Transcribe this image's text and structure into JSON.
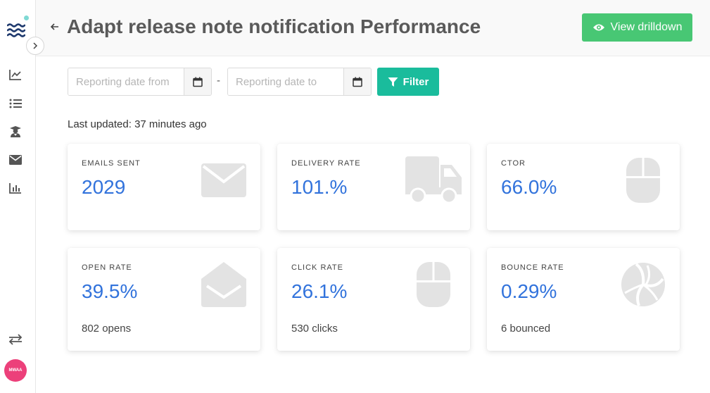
{
  "header": {
    "title": "Adapt release note notification Performance",
    "drilldown_label": "View drilldown"
  },
  "filters": {
    "date_from_placeholder": "Reporting date from",
    "date_to_placeholder": "Reporting date to",
    "separator": "-",
    "filter_label": "Filter"
  },
  "last_updated": "Last updated: 37 minutes ago",
  "sidebar": {
    "avatar_text": "MWAA",
    "icons": [
      "chart-line-icon",
      "list-icon",
      "user-graduate-icon",
      "envelope-icon",
      "bar-chart-icon",
      "exchange-icon"
    ]
  },
  "cards": [
    {
      "label": "EMAILS SENT",
      "value": "2029",
      "sub": "",
      "icon": "envelope-icon"
    },
    {
      "label": "DELIVERY RATE",
      "value": "101.%",
      "sub": "",
      "icon": "truck-icon"
    },
    {
      "label": "CTOR",
      "value": "66.0%",
      "sub": "",
      "icon": "mouse-icon"
    },
    {
      "label": "OPEN RATE",
      "value": "39.5%",
      "sub": "802 opens",
      "icon": "envelope-open-icon"
    },
    {
      "label": "CLICK RATE",
      "value": "26.1%",
      "sub": "530 clicks",
      "icon": "mouse-icon"
    },
    {
      "label": "BOUNCE RATE",
      "value": "0.29%",
      "sub": "6 bounced",
      "icon": "volleyball-icon"
    }
  ],
  "colors": {
    "accent_blue": "#3273dc",
    "success_green": "#48c774",
    "filter_teal": "#1abc9c",
    "avatar_pink": "#ec407a",
    "icon_gray": "#e3e3e3"
  }
}
